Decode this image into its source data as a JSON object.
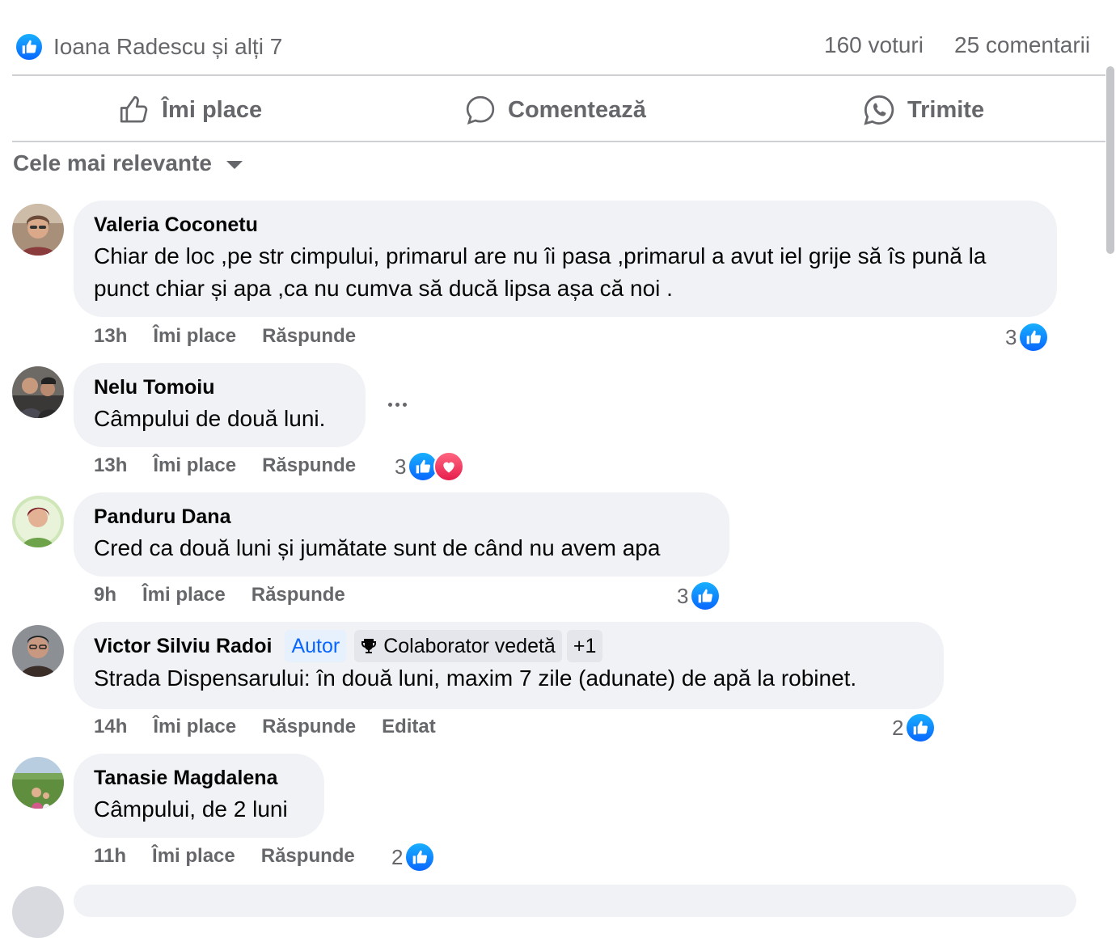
{
  "summary": {
    "reactions_text": "Ioana Radescu și alți 7",
    "votes": "160 voturi",
    "comments": "25 comentarii"
  },
  "actions": {
    "like": "Îmi place",
    "comment": "Comentează",
    "share": "Trimite"
  },
  "sort": {
    "label": "Cele mai relevante"
  },
  "colors": {
    "accent": "#0866ff",
    "love": "#e61e4d",
    "bubble": "#f0f2f5",
    "muted_text": "#65676b"
  },
  "comments": [
    {
      "author": "Valeria Coconetu",
      "text": "Chiar de loc ,pe str cimpului, primarul are nu îi pasa ,primarul a avut iel grije să îs pună la punct chiar și apa ,ca nu cumva să ducă lipsa așa că noi .",
      "time": "13h",
      "like": "Îmi place",
      "reply": "Răspunde",
      "reactions": "3"
    },
    {
      "author": "Nelu Tomoiu",
      "text": "Câmpului de două luni.",
      "time": "13h",
      "like": "Îmi place",
      "reply": "Răspunde",
      "reactions": "3"
    },
    {
      "author": "Panduru Dana",
      "text": "Cred ca două luni și jumătate sunt de când nu avem apa",
      "time": "9h",
      "like": "Îmi place",
      "reply": "Răspunde",
      "reactions": "3"
    },
    {
      "author": "Victor Silviu Radoi",
      "badge_author": "Autor",
      "badge_top": "Colaborator vedetă",
      "badge_more": "+1",
      "text": "Strada Dispensarului: în două luni, maxim 7 zile (adunate) de apă la robinet.",
      "time": "14h",
      "like": "Îmi place",
      "reply": "Răspunde",
      "edited": "Editat",
      "reactions": "2"
    },
    {
      "author": "Tanasie Magdalena",
      "text": "Câmpului, de 2 luni",
      "time": "11h",
      "like": "Îmi place",
      "reply": "Răspunde",
      "reactions": "2"
    }
  ],
  "icons": [
    "like-icon",
    "comment-icon",
    "whatsapp-icon",
    "heart-icon",
    "trophy-icon",
    "more-icon",
    "dropdown-caret-icon"
  ]
}
